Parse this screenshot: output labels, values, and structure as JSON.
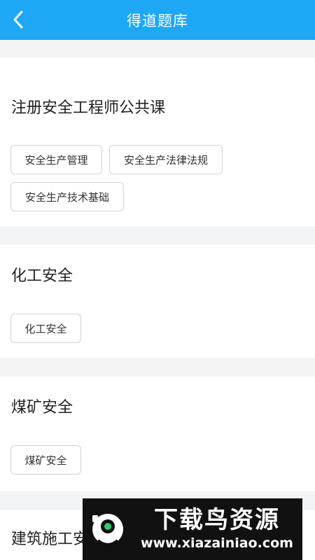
{
  "header": {
    "title": "得道题库"
  },
  "sections": [
    {
      "title": "注册安全工程师公共课",
      "chips": [
        "安全生产管理",
        "安全生产法律法规",
        "安全生产技术基础"
      ]
    },
    {
      "title": "化工安全",
      "chips": [
        "化工安全"
      ]
    },
    {
      "title": "煤矿安全",
      "chips": [
        "煤矿安全"
      ]
    },
    {
      "title": "建筑施工安全"
    }
  ],
  "watermark": {
    "brand": "下载鸟资源",
    "url": "www.xiazainiao.com"
  },
  "colors": {
    "header_bg": "#1ea7f5",
    "page_bg": "#f3f4f6",
    "chip_border": "#cfd3d8"
  }
}
